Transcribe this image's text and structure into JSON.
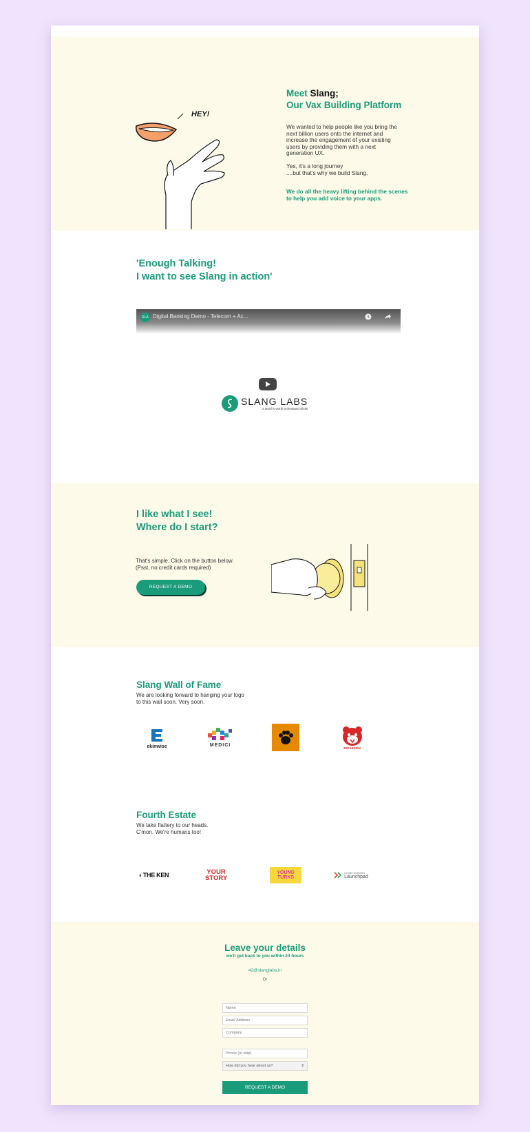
{
  "hero": {
    "title_meet": "Meet",
    "title_brand": "Slang;",
    "title_line2": "Our Vax Building Platform",
    "hey": "HEY!",
    "para1_lines": [
      "We wanted to help people like you bring the",
      "next billion users onto the internet and",
      "increase the engagement of your existing",
      "users by providing them with a next",
      "generation UX."
    ],
    "para2_lines": [
      "Yes, it's a long journey",
      "....but that's why we build Slang."
    ],
    "para3_lines": [
      "We do all the heavy lifting behind the scenes",
      "to help you add voice to your apps."
    ]
  },
  "video_section": {
    "title_lines": [
      "'Enough Talking!",
      "I want to see Slang in action'"
    ],
    "video_title": "Digital Banking Demo - Telecom + Ac...",
    "channel_badge": "SLA",
    "logo_name": "SLANG LABS",
    "logo_tagline": "a word is worth a thousand clicks"
  },
  "start_section": {
    "title_lines": [
      "I like what I see!",
      "Where do I start?"
    ],
    "text_lines": [
      "That's simple. Click on the button below.",
      "(Psst, no credit cards required)"
    ],
    "button": "REQUEST A DEMO"
  },
  "fame": {
    "title": "Slang Wall of Fame",
    "text_lines": [
      "We are looking forward to hanging your logo",
      "to this wall soon. Very soon."
    ],
    "logos": [
      "ekinwise",
      "MEDICI",
      "paw-logo",
      "BIGASKIRA"
    ]
  },
  "fourth_estate": {
    "title": "Fourth Estate",
    "text_lines": [
      "We take flattery to our heads.",
      "C'mon. We're humans too!"
    ],
    "press": [
      "THE KEN",
      "YOUR STORY",
      "YOUNG TURKS",
      "Launchpad"
    ],
    "press_small": "Google Developers"
  },
  "contact": {
    "title": "Leave your details",
    "subtitle": "we'll get back to you within 24 hours",
    "email": "42@slanglabs.in",
    "or": "Or",
    "placeholders": {
      "name": "Name",
      "email": "Email Address",
      "company": "Company",
      "phone": "Phone (or skip)"
    },
    "select_value": "How did you hear about us?",
    "submit": "REQUEST A DEMO"
  },
  "colors": {
    "accent": "#1a9b79",
    "cream": "#fdfae9",
    "backdrop": "#efe3fd"
  }
}
